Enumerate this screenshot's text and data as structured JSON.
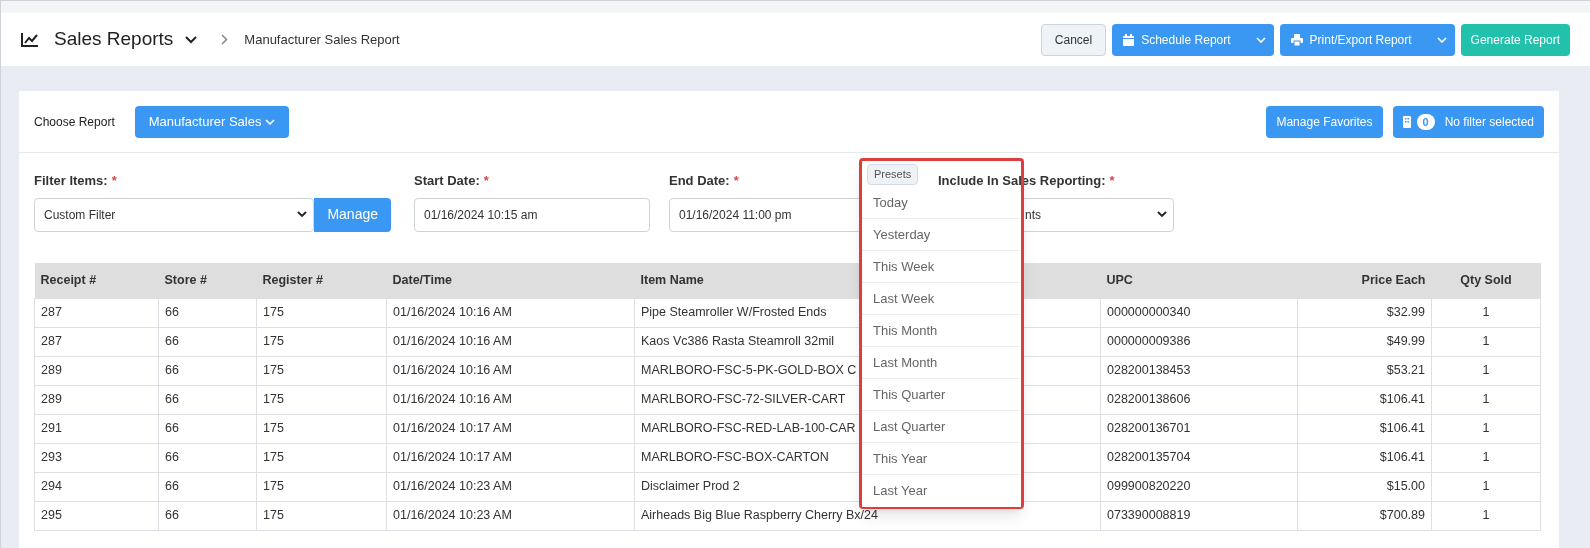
{
  "header": {
    "title": "Sales Reports",
    "breadcrumb": "Manufacturer Sales Report",
    "buttons": [
      {
        "label": "Cancel",
        "kind": "plain"
      },
      {
        "label": "Schedule Report",
        "kind": "calendar"
      },
      {
        "label": "Print/Export Report",
        "kind": "print"
      },
      {
        "label": "Generate Report",
        "kind": "primary"
      }
    ]
  },
  "report": {
    "label": "Choose Report",
    "value": "Manufacturer Sales",
    "favorites": "Manage Favorites",
    "filter_count": "0",
    "filter_status": "No filter selected"
  },
  "filters": [
    {
      "label": "Filter Items:",
      "required_mark": "*",
      "kind": "select",
      "value": "Custom Filter",
      "button": "Manage"
    },
    {
      "label": "Start Date:",
      "required_mark": "*",
      "kind": "date",
      "value": "01/16/2024 10:15 am"
    },
    {
      "label": "End Date:",
      "required_mark": "*",
      "kind": "date",
      "value": "01/16/2024 11:00 pm"
    },
    {
      "label": "Include In Sales Reporting:",
      "required_mark": "*",
      "kind": "select",
      "value": "nts"
    }
  ],
  "presets": {
    "button": "Presets",
    "items": [
      "Today",
      "Yesterday",
      "This Week",
      "Last Week",
      "This Month",
      "Last Month",
      "This Quarter",
      "Last Quarter",
      "This Year",
      "Last Year"
    ]
  },
  "table": {
    "columns": [
      "Receipt #",
      "Store #",
      "Register #",
      "Date/Time",
      "Item Name",
      "UPC",
      "Price Each",
      "Qty Sold"
    ],
    "rows": [
      [
        "287",
        "66",
        "175",
        "01/16/2024 10:16 AM",
        "Pipe Steamroller W/Frosted Ends",
        "000000000340",
        "$32.99",
        "1"
      ],
      [
        "287",
        "66",
        "175",
        "01/16/2024 10:16 AM",
        "Kaos Vc386 Rasta Steamroll 32mil",
        "000000009386",
        "$49.99",
        "1"
      ],
      [
        "289",
        "66",
        "175",
        "01/16/2024 10:16 AM",
        "MARLBORO-FSC-5-PK-GOLD-BOX C",
        "028200138453",
        "$53.21",
        "1"
      ],
      [
        "289",
        "66",
        "175",
        "01/16/2024 10:16 AM",
        "MARLBORO-FSC-72-SILVER-CART",
        "028200138606",
        "$106.41",
        "1"
      ],
      [
        "291",
        "66",
        "175",
        "01/16/2024 10:17 AM",
        "MARLBORO-FSC-RED-LAB-100-CAR",
        "028200136701",
        "$106.41",
        "1"
      ],
      [
        "293",
        "66",
        "175",
        "01/16/2024 10:17 AM",
        "MARLBORO-FSC-BOX-CARTON",
        "028200135704",
        "$106.41",
        "1"
      ],
      [
        "294",
        "66",
        "175",
        "01/16/2024 10:23 AM",
        "Disclaimer Prod 2",
        "099900820220",
        "$15.00",
        "1"
      ],
      [
        "295",
        "66",
        "175",
        "01/16/2024 10:23 AM",
        "Airheads Big Blue Raspberry Cherry Bx/24",
        "073390008819",
        "$700.89",
        "1"
      ]
    ]
  }
}
